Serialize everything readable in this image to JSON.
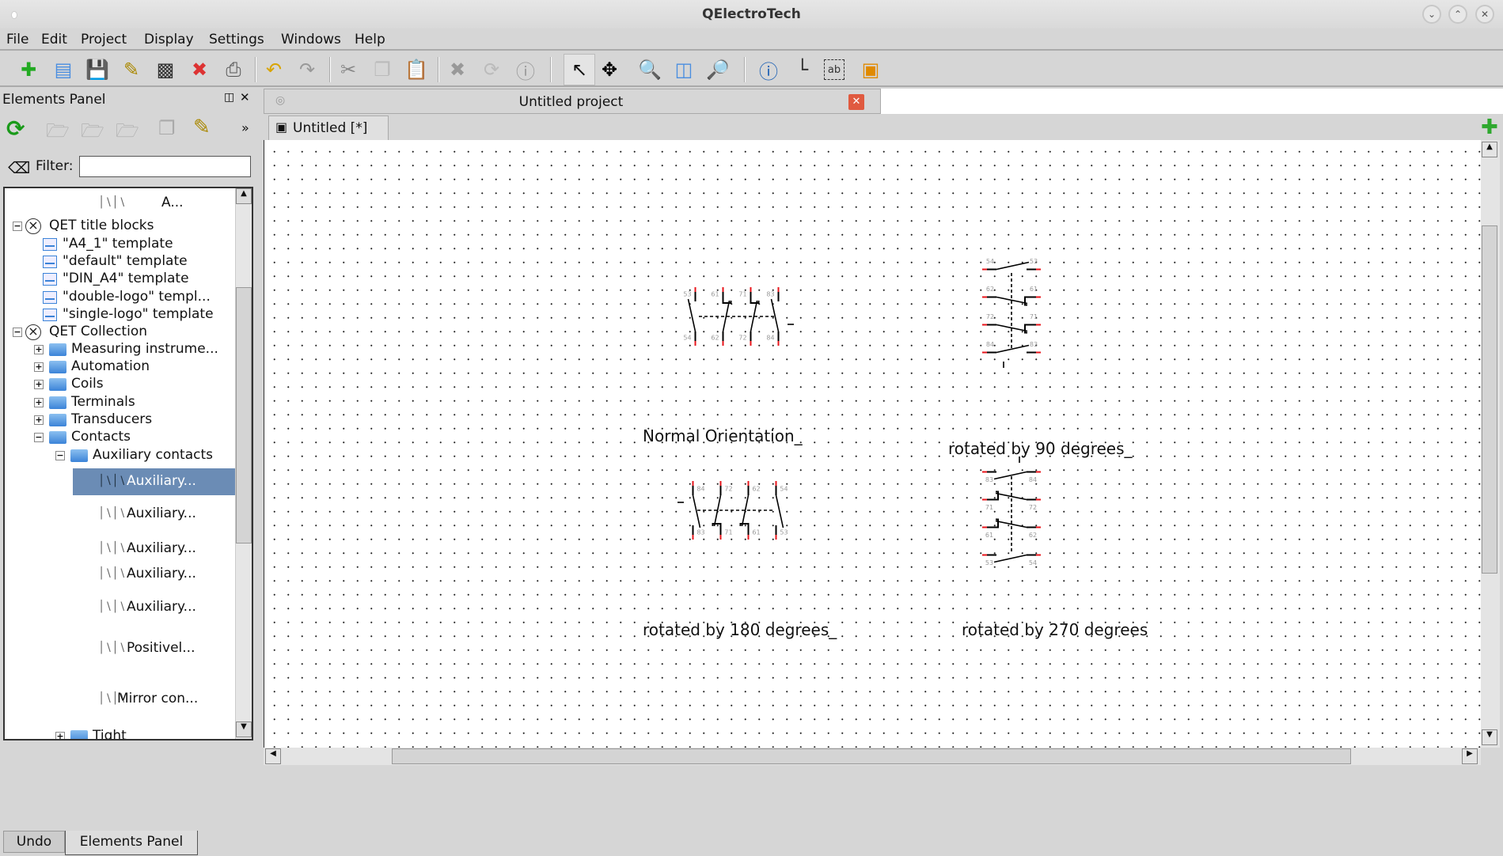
{
  "window": {
    "title": "QElectroTech",
    "controls": [
      "minimize",
      "maximize",
      "close"
    ]
  },
  "menu": [
    "File",
    "Edit",
    "Project",
    "Display",
    "Settings",
    "Windows",
    "Help"
  ],
  "toolbar": {
    "icons": [
      "new-project-icon",
      "open-icon",
      "save-icon",
      "save-as-icon",
      "save-all-icon",
      "close-project-icon",
      "print-icon",
      "undo-icon",
      "redo-icon",
      "cut-icon",
      "copy-icon",
      "paste-icon",
      "delete-icon",
      "rotate-icon",
      "properties-icon",
      "select-icon",
      "move-icon",
      "zoom-fit-icon",
      "zoom-page-icon",
      "zoom-reset-icon",
      "info-icon",
      "conductor-icon",
      "text-icon",
      "add-image-icon"
    ]
  },
  "elements_panel": {
    "title": "Elements Panel",
    "filter_label": "Filter:",
    "filter_value": "",
    "tree": [
      {
        "label": "A...",
        "level": 3,
        "kind": "element"
      },
      {
        "label": "QET title blocks",
        "level": 0,
        "kind": "root",
        "expanded": true
      },
      {
        "label": "\"A4_1\" template",
        "level": 1,
        "kind": "template"
      },
      {
        "label": "\"default\" template",
        "level": 1,
        "kind": "template"
      },
      {
        "label": "\"DIN_A4\" template",
        "level": 1,
        "kind": "template"
      },
      {
        "label": "\"double-logo\" templ...",
        "level": 1,
        "kind": "template"
      },
      {
        "label": "\"single-logo\" template",
        "level": 1,
        "kind": "template"
      },
      {
        "label": "QET Collection",
        "level": 0,
        "kind": "root",
        "expanded": true
      },
      {
        "label": "Measuring instrume...",
        "level": 1,
        "kind": "folder",
        "expanded": false
      },
      {
        "label": "Automation",
        "level": 1,
        "kind": "folder",
        "expanded": false
      },
      {
        "label": "Coils",
        "level": 1,
        "kind": "folder",
        "expanded": false
      },
      {
        "label": "Terminals",
        "level": 1,
        "kind": "folder",
        "expanded": false
      },
      {
        "label": "Transducers",
        "level": 1,
        "kind": "folder",
        "expanded": false
      },
      {
        "label": "Contacts",
        "level": 1,
        "kind": "folder",
        "expanded": true
      },
      {
        "label": "Auxiliary contacts",
        "level": 2,
        "kind": "folder",
        "expanded": true
      },
      {
        "label": "Auxiliary...",
        "level": 3,
        "kind": "element",
        "selected": true
      },
      {
        "label": "Auxiliary...",
        "level": 3,
        "kind": "element"
      },
      {
        "label": "Auxiliary...",
        "level": 3,
        "kind": "element"
      },
      {
        "label": "Auxiliary...",
        "level": 3,
        "kind": "element"
      },
      {
        "label": "Auxiliary...",
        "level": 3,
        "kind": "element"
      },
      {
        "label": "Positivel...",
        "level": 3,
        "kind": "element"
      },
      {
        "label": "Mirror con...",
        "level": 3,
        "kind": "element"
      },
      {
        "label": "Tight",
        "level": 2,
        "kind": "folder",
        "expanded": false
      }
    ],
    "bottom_tabs": [
      "Undo",
      "Elements Panel"
    ],
    "active_bottom_tab": "Elements Panel"
  },
  "project": {
    "tab_title": "Untitled project",
    "diagram_tab": "Untitled [*]"
  },
  "diagram": {
    "labels": {
      "normal": "Normal Orientation_",
      "r90": "rotated by 90 degrees_",
      "r180": "rotated by 180 degrees_",
      "r270": "rotated by 270 degrees"
    },
    "poles": [
      {
        "type": "NO",
        "top": "53",
        "bottom": "54"
      },
      {
        "type": "NC",
        "top": "61",
        "bottom": "62"
      },
      {
        "type": "NC",
        "top": "71",
        "bottom": "72"
      },
      {
        "type": "NO",
        "top": "83",
        "bottom": "84"
      }
    ],
    "rotations": [
      0,
      90,
      180,
      270
    ]
  },
  "colors": {
    "selection": "#6b8cb5",
    "terminal": "#e8151b",
    "terminal_tip": "#1a1aff",
    "close_tab": "#e05a40",
    "add_green": "#2fa82f"
  }
}
